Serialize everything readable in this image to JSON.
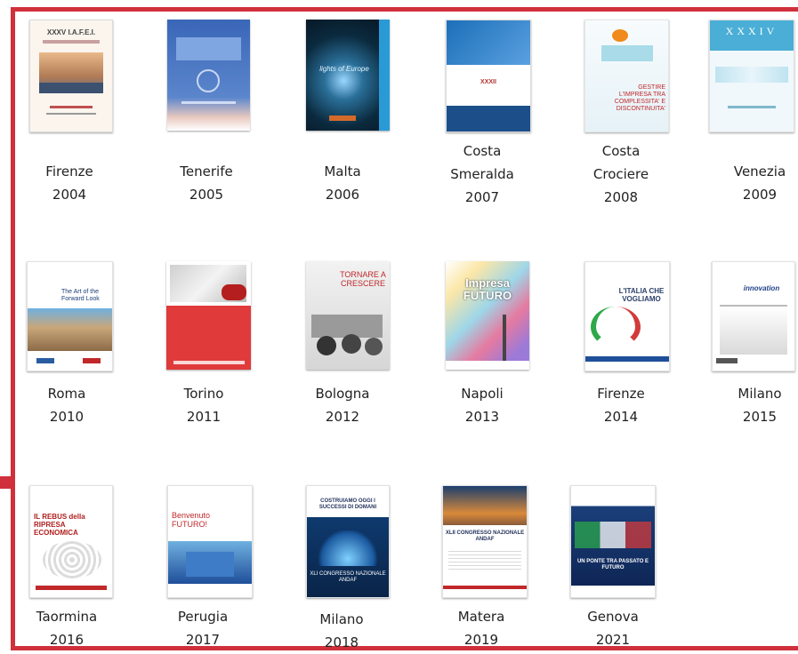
{
  "colors": {
    "frame": "#d0303b"
  },
  "items": [
    {
      "name": "firenze-2004",
      "line1": "Firenze",
      "line2": "2004",
      "line0": ""
    },
    {
      "name": "tenerife-2005",
      "line1": "Tenerife",
      "line2": "2005",
      "line0": ""
    },
    {
      "name": "malta-2006",
      "line1": "Malta",
      "line2": "2006",
      "line0": ""
    },
    {
      "name": "costa-smeralda-2007",
      "line0": "Costa",
      "line1": "Smeralda",
      "line2": "2007"
    },
    {
      "name": "costa-crociere-2008",
      "line0": "Costa",
      "line1": "Crociere",
      "line2": "2008"
    },
    {
      "name": "venezia-2009",
      "line1": "Venezia",
      "line2": "2009",
      "line0": ""
    },
    {
      "name": "roma-2010",
      "line1": "Roma",
      "line2": "2010"
    },
    {
      "name": "torino-2011",
      "line1": "Torino",
      "line2": "2011"
    },
    {
      "name": "bologna-2012",
      "line1": "Bologna",
      "line2": "2012"
    },
    {
      "name": "napoli-2013",
      "line1": "Napoli",
      "line2": "2013"
    },
    {
      "name": "firenze-2014",
      "line1": "Firenze",
      "line2": "2014"
    },
    {
      "name": "milano-2015",
      "line1": "Milano",
      "line2": "2015"
    },
    {
      "name": "taormina-2016",
      "line1": "Taormina",
      "line2": "2016"
    },
    {
      "name": "perugia-2017",
      "line1": "Perugia",
      "line2": "2017"
    },
    {
      "name": "milano-2018",
      "line1": "Milano",
      "line2": "2018"
    },
    {
      "name": "matera-2019",
      "line1": "Matera",
      "line2": "2019"
    },
    {
      "name": "genova-2021",
      "line1": "Genova",
      "line2": "2021"
    }
  ],
  "cover_text": {
    "c2004": "XXXV I.A.F.E.I.",
    "c2006": "lights of Europe",
    "c2007": "XXXII",
    "c2008": "GESTIRE L'IMPRESA TRA COMPLESSITA' E DISCONTINUITA'",
    "c2009": "XXXIV",
    "c2010": "The Art of the Forward Look",
    "c2012": "TORNARE A CRESCERE",
    "c2013": "Impresa FUTURO",
    "c2014": "L'ITALIA CHE VOGLIAMO",
    "c2015": "innovation",
    "c2016": "IL REBUS della RIPRESA ECONOMICA",
    "c2017": "Benvenuto FUTURO!",
    "c2018": "COSTRUIAMO OGGI I SUCCESSI DI DOMANI",
    "c2018b": "XLI CONGRESSO NAZIONALE ANDAF",
    "c2019": "XLII CONGRESSO NAZIONALE ANDAF",
    "c2021": "UN PONTE TRA PASSATO E FUTURO"
  }
}
